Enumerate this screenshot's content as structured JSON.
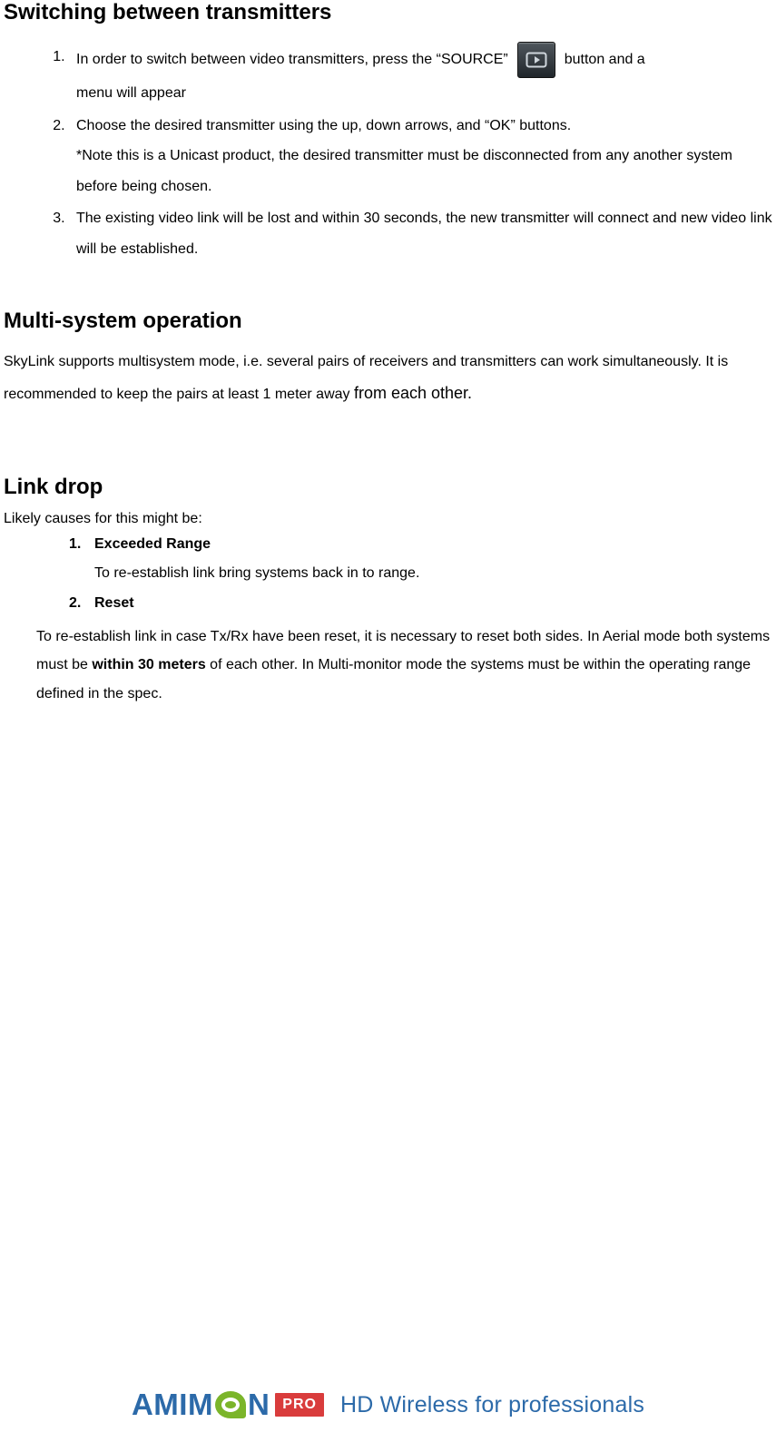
{
  "headings": {
    "switching": "Switching between transmitters",
    "multisystem": "Multi-system operation",
    "linkdrop": "Link drop"
  },
  "switch_steps": {
    "s1_a": "In order to switch between video transmitters, press the “SOURCE”",
    "s1_b": "button and a",
    "s1_c": "menu will appear",
    "s2_a": "Choose the desired transmitter using the up, down arrows, and “OK” buttons.",
    "s2_b": "*Note this is a Unicast product, the desired transmitter must be disconnected from any another system before being chosen.",
    "s3": "The existing video link will be lost and within 30 seconds, the new transmitter will connect and new video link will be established."
  },
  "multisystem_para_a": "SkyLink supports multisystem mode, i.e. several pairs of receivers and transmitters can work simultaneously. It is recommended to keep the pairs at least 1 meter away ",
  "multisystem_para_b": "from each other.",
  "linkdrop_intro": "Likely causes for this might be:",
  "linkdrop_items": [
    {
      "title": "Exceeded Range",
      "body": "To re-establish link bring systems back in to range."
    },
    {
      "title": "Reset",
      "body": ""
    }
  ],
  "reset_body_a": "To re-establish link in case Tx/Rx have been reset, it is necessary to reset both sides. In Aerial mode both systems must be ",
  "reset_body_b": "within 30 meters",
  "reset_body_c": " of each other. In Multi-monitor mode the systems must be within the operating range defined in the spec.",
  "footer": {
    "brand_a": "AMIM",
    "brand_b": "N",
    "pro": "PRO",
    "tagline": "HD Wireless for professionals"
  },
  "icon_name": "source-button-icon"
}
